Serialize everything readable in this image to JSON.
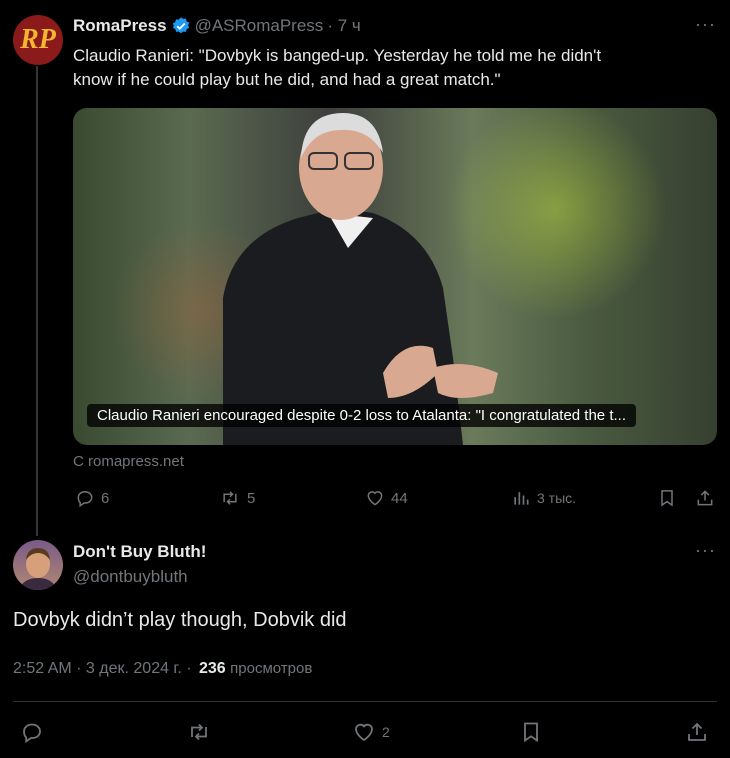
{
  "tweet1": {
    "avatar_text": "RP",
    "name": "RomaPress",
    "handle": "@ASRomaPress",
    "time": "· 7 ч",
    "text_line1": "Claudio Ranieri: \"Dovbyk is banged-up. Yesterday he told me he didn't",
    "text_line2": "know if he could play but he did, and had a great match.\"",
    "card_caption": "Claudio Ranieri encouraged despite 0-2 loss to Atalanta: \"I congratulated the t...",
    "card_source": "С romapress.net",
    "actions": {
      "replies": "6",
      "reposts": "5",
      "likes": "44",
      "views": "3 тыс."
    }
  },
  "tweet2": {
    "name": "Don't Buy Bluth!",
    "handle": "@dontbuybluth",
    "text": "Dovbyk didn’t play though, Dobvik did",
    "meta_time": "2:52 AM · 3 дек. 2024 г. ·",
    "views_count": "236",
    "views_label": "просмотров",
    "actions": {
      "likes": "2"
    }
  },
  "colors": {
    "accent": "#1d9bf0",
    "muted": "#71767b",
    "divider": "#2f3336",
    "avatar_red": "#8b1a1a",
    "avatar_gold": "#f2b632"
  }
}
